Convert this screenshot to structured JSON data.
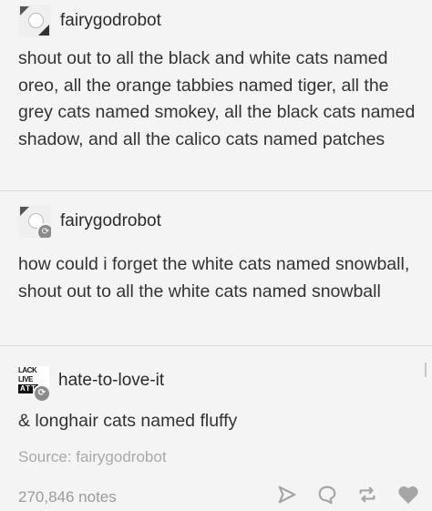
{
  "posts": [
    {
      "username": "fairygodrobot",
      "text": "shout out to all the black and white cats named oreo, all the orange tabbies named tiger, all the grey cats named smokey, all the black cats named shadow, and all the calico cats named patches"
    },
    {
      "username": "fairygodrobot",
      "text": "how could i forget the white cats named snowball, shout out to all the white cats named snowball"
    },
    {
      "username": "hate-to-love-it",
      "avatar_text": [
        "LACK LIVE",
        "ATT"
      ],
      "text": "& longhair cats named fluffy"
    }
  ],
  "source": "Source: fairygodrobot",
  "notes": "270,846 notes",
  "icons": {
    "share": "share-icon",
    "reply": "reply-icon",
    "reblog": "reblog-icon",
    "like": "heart-icon"
  },
  "colors": {
    "background": "#f4f4f4",
    "text": "#333333",
    "muted": "#9b9b9b",
    "icon": "#a6a6a6"
  }
}
